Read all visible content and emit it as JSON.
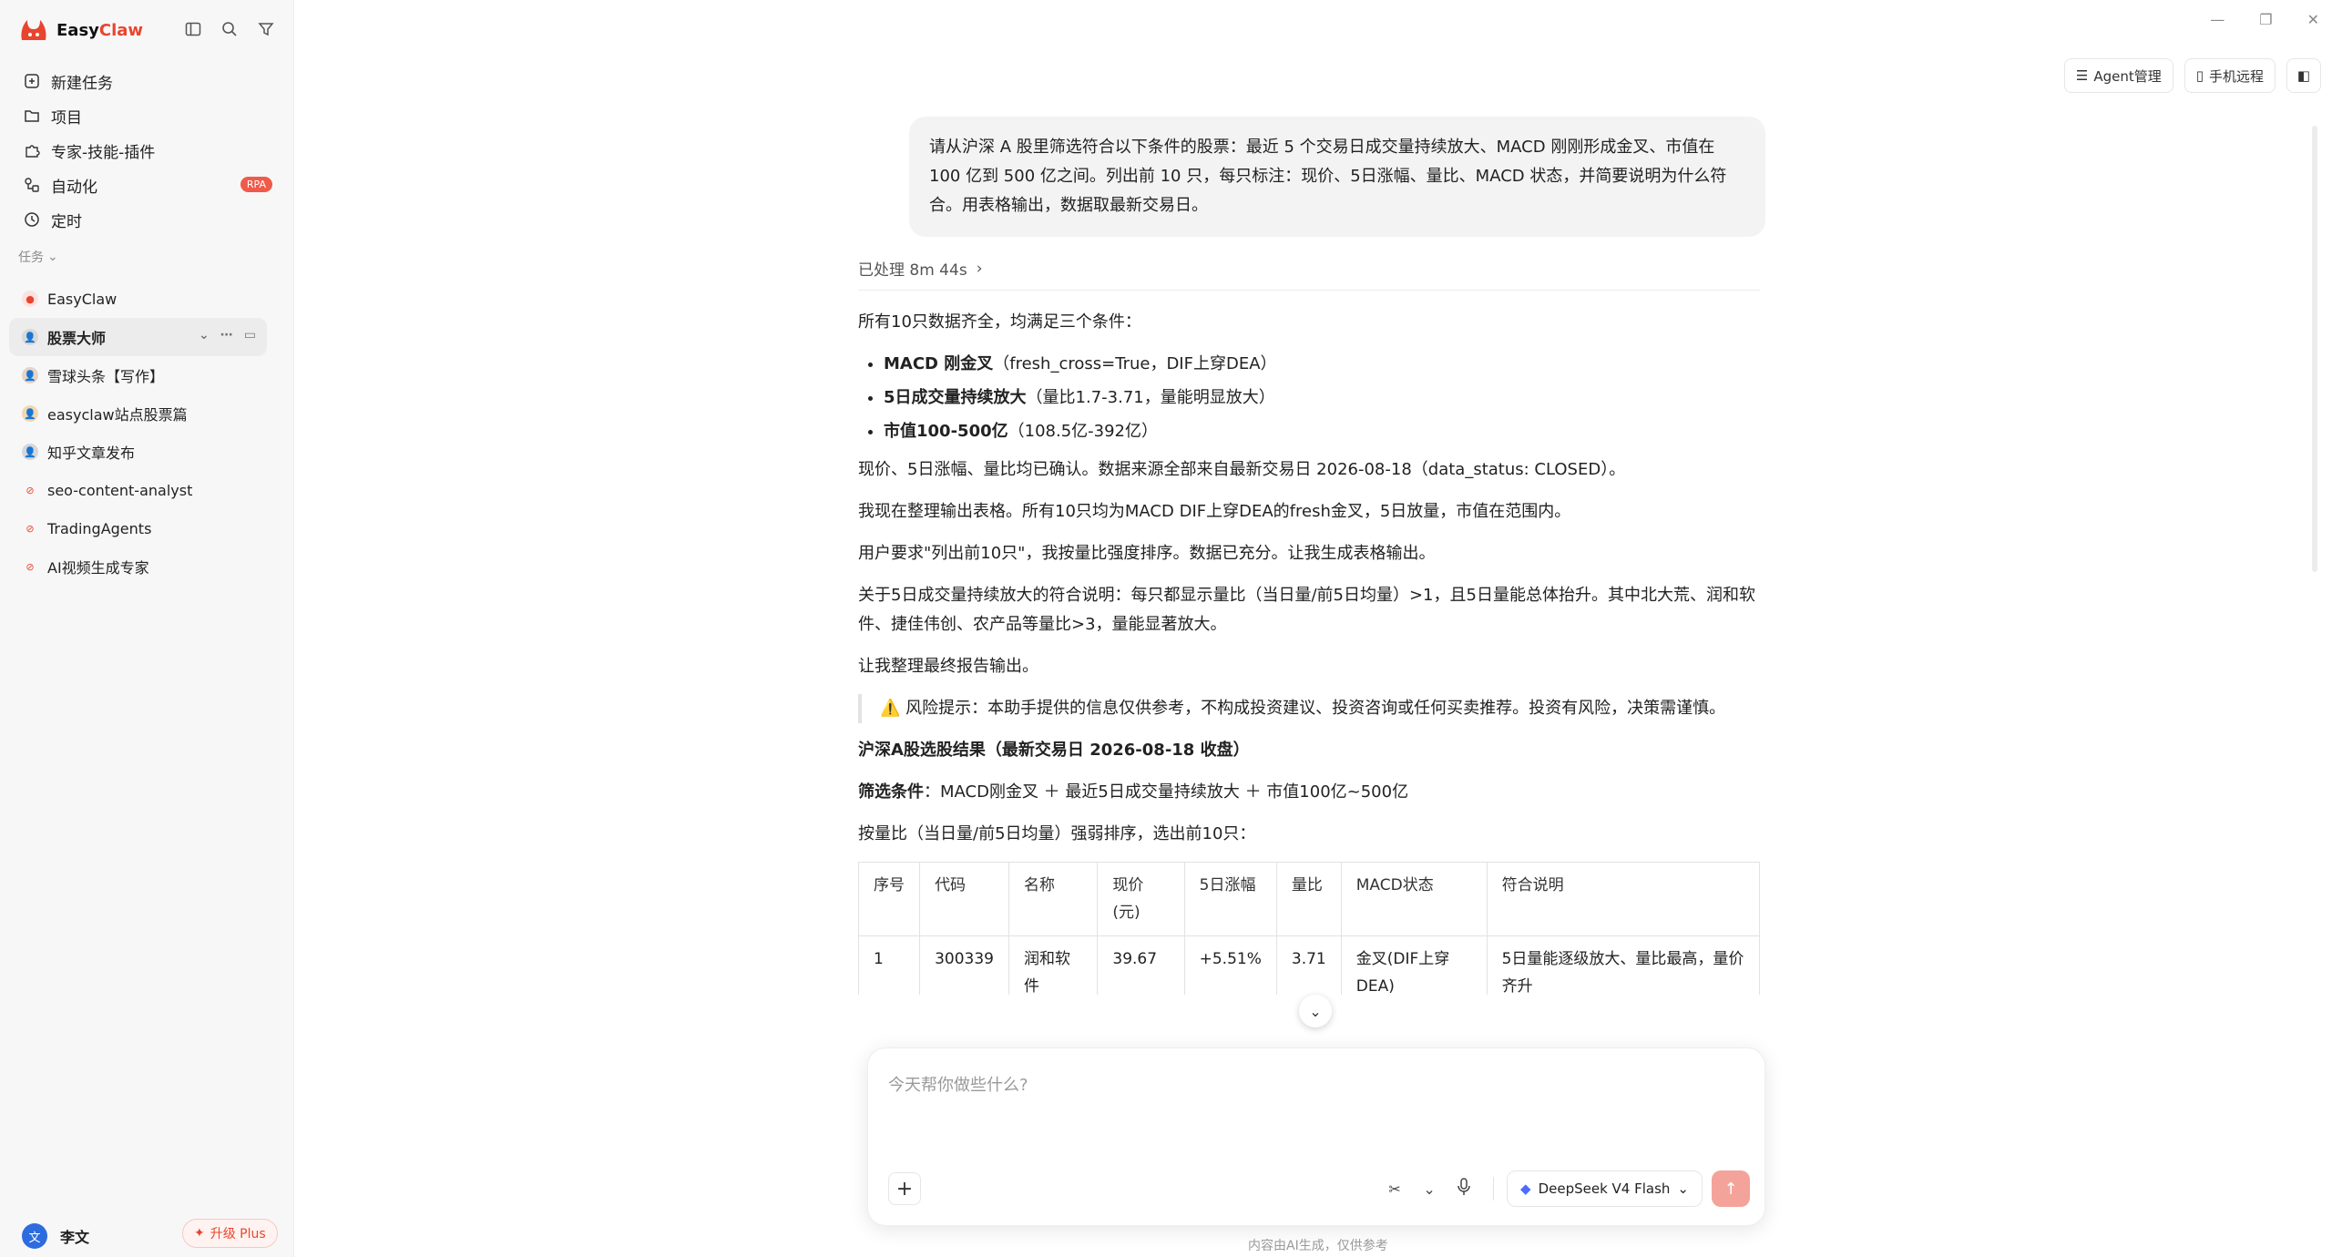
{
  "app": {
    "name_prefix": "Easy",
    "name_suffix": "Claw",
    "brand_color": "#e8452e"
  },
  "sidebar": {
    "nav": [
      {
        "label": "新建任务",
        "icon": "new-task-icon"
      },
      {
        "label": "项目",
        "icon": "folder-icon"
      },
      {
        "label": "专家-技能-插件",
        "icon": "puzzle-icon"
      },
      {
        "label": "自动化",
        "icon": "automation-icon",
        "badge": "RPA"
      },
      {
        "label": "定时",
        "icon": "clock-icon"
      }
    ],
    "section_label": "任务",
    "tasks": [
      {
        "label": "EasyClaw"
      },
      {
        "label": "股票大师",
        "active": true
      },
      {
        "label": "雪球头条【写作】"
      },
      {
        "label": "easyclaw站点股票篇"
      },
      {
        "label": "知乎文章发布"
      },
      {
        "label": "seo-content-analyst"
      },
      {
        "label": "TradingAgents"
      },
      {
        "label": "AI视频生成专家"
      }
    ],
    "user": {
      "name": "李文",
      "avatar_text": "文"
    },
    "upgrade_label": "升级 Plus"
  },
  "header": {
    "agent_btn": "Agent管理",
    "phone_btn": "手机远程"
  },
  "chat": {
    "user_message": "请从沪深 A 股里筛选符合以下条件的股票：最近 5 个交易日成交量持续放大、MACD 刚刚形成金叉、市值在 100 亿到 500 亿之间。列出前 10 只，每只标注：现价、5日涨幅、量比、MACD 状态，并简要说明为什么符合。用表格输出，数据取最新交易日。",
    "processed": "已处理 8m 44s",
    "intro": "所有10只数据齐全，均满足三个条件：",
    "bullets": [
      {
        "bold": "MACD 刚金叉",
        "text": "（fresh_cross=True，DIF上穿DEA）"
      },
      {
        "bold": "5日成交量持续放大",
        "text": "（量比1.7-3.71，量能明显放大）"
      },
      {
        "bold": "市值100-500亿",
        "text": "（108.5亿-392亿）"
      }
    ],
    "p1": "现价、5日涨幅、量比均已确认。数据来源全部来自最新交易日 2026-08-18（data_status: CLOSED）。",
    "p2": "我现在整理输出表格。所有10只均为MACD DIF上穿DEA的fresh金叉，5日放量，市值在范围内。",
    "p3": "用户要求\"列出前10只\"，我按量比强度排序。数据已充分。让我生成表格输出。",
    "p4": "关于5日成交量持续放大的符合说明：每只都显示量比（当日量/前5日均量）>1，且5日量能总体抬升。其中北大荒、润和软件、捷佳伟创、农产品等量比>3，量能显著放大。",
    "p5": "让我整理最终报告输出。",
    "warning_icon": "⚠️",
    "warning": "风险提示：本助手提供的信息仅供参考，不构成投资建议、投资咨询或任何买卖推荐。投资有风险，决策需谨慎。",
    "result_title": "沪深A股选股结果（最新交易日 2026-08-18 收盘）",
    "filter_label": "筛选条件",
    "filter_text": "：MACD刚金叉 ＋ 最近5日成交量持续放大 ＋ 市值100亿~500亿",
    "sort_text": "按量比（当日量/前5日均量）强弱排序，选出前10只：",
    "table": {
      "headers": [
        "序号",
        "代码",
        "名称",
        "现价(元)",
        "5日涨幅",
        "量比",
        "MACD状态",
        "符合说明"
      ],
      "rows": [
        [
          "1",
          "300339",
          "润和软件",
          "39.67",
          "+5.51%",
          "3.71",
          "金叉(DIF上穿DEA)",
          "5日量能逐级放大、量比最高，量价齐升"
        ]
      ]
    }
  },
  "composer": {
    "placeholder": "今天帮你做些什么?",
    "model": "DeepSeek V4 Flash",
    "footnote": "内容由AI生成，仅供参考"
  }
}
